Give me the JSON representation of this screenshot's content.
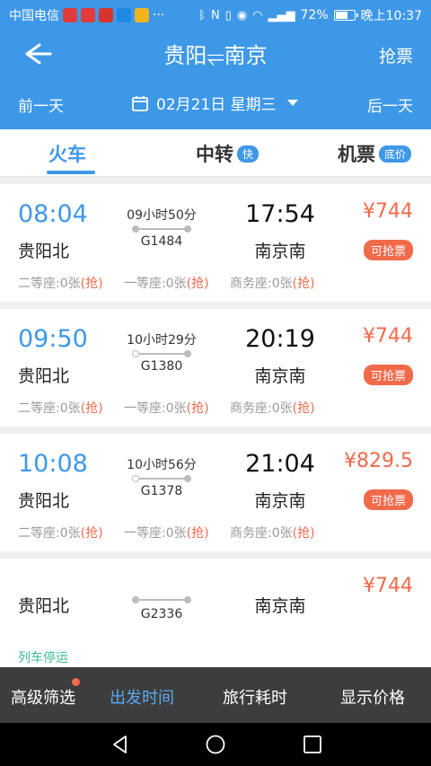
{
  "status_bar": {
    "carrier": "中国电信",
    "more": "···",
    "battery": "72%",
    "battery_level": 0.72,
    "time": "晚上10:37",
    "app_icon_colors": [
      "#e23b3b",
      "#e23b3b",
      "#d9342b",
      "#1e88e5",
      "#f2b51b"
    ]
  },
  "header": {
    "title": "贵阳⥫南京",
    "right_button": "抢票",
    "prev_day": "前一天",
    "next_day": "后一天",
    "date": "02月21日 星期三"
  },
  "tabs": [
    {
      "label": "火车"
    },
    {
      "label": "中转",
      "badge": "快"
    },
    {
      "label": "机票",
      "badge": "底价"
    }
  ],
  "trains": [
    {
      "dep_time": "08:04",
      "dep_station": "贵阳北",
      "duration": "09小时50分",
      "train_no": "G1484",
      "arr_time": "17:54",
      "arr_station": "南京南",
      "price": "¥744",
      "tag": "可抢票",
      "seats": [
        {
          "label": "二等座:0张",
          "grab": "(抢)"
        },
        {
          "label": "一等座:0张",
          "grab": "(抢)"
        },
        {
          "label": "商务座:0张",
          "grab": "(抢)"
        }
      ]
    },
    {
      "dep_time": "09:50",
      "dep_station": "贵阳北",
      "duration": "10小时29分",
      "train_no": "G1380",
      "arr_time": "20:19",
      "arr_station": "南京南",
      "price": "¥744",
      "tag": "可抢票",
      "seats": [
        {
          "label": "二等座:0张",
          "grab": "(抢)"
        },
        {
          "label": "一等座:0张",
          "grab": "(抢)"
        },
        {
          "label": "商务座:0张",
          "grab": "(抢)"
        }
      ]
    },
    {
      "dep_time": "10:08",
      "dep_station": "贵阳北",
      "duration": "10小时56分",
      "train_no": "G1378",
      "arr_time": "21:04",
      "arr_station": "南京南",
      "price": "¥829.5",
      "tag": "可抢票",
      "seats": [
        {
          "label": "二等座:0张",
          "grab": "(抢)"
        },
        {
          "label": "一等座:0张",
          "grab": "(抢)"
        },
        {
          "label": "商务座:0张",
          "grab": "(抢)"
        }
      ]
    },
    {
      "dep_station": "贵阳北",
      "train_no": "G2336",
      "arr_station": "南京南",
      "price": "¥744",
      "note": "列车停运"
    }
  ],
  "filter_bar": {
    "filter": "高级筛选",
    "depart_time": "出发时间",
    "travel_time": "旅行耗时",
    "show_price": "显示价格"
  },
  "colors": {
    "primary": "#3e98e8",
    "price": "#f16a4a",
    "suspended": "#3cbd8f",
    "filter_bg": "#3d3d3d"
  }
}
